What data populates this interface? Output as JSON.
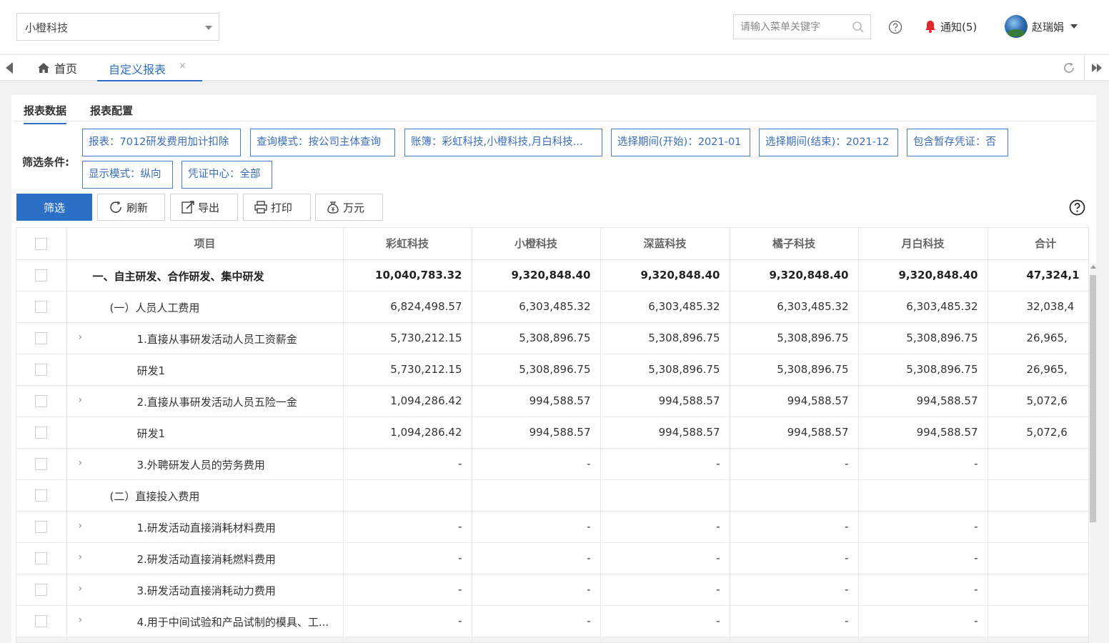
{
  "header": {
    "company_select": "小橙科技",
    "search_placeholder": "请输入菜单关键字",
    "notify_label": "通知(5)",
    "user_name": "赵瑞娟"
  },
  "tabs": {
    "home": "首页",
    "custom_report": "自定义报表",
    "close_symbol": "×"
  },
  "subtabs": {
    "data": "报表数据",
    "config": "报表配置"
  },
  "filters": {
    "label": "筛选条件:",
    "chips": [
      "报表：7012研发费用加计扣除",
      "查询模式：按公司主体查询",
      "账簿：彩虹科技,小橙科技,月白科技...",
      "选择期间(开始)：2021-01",
      "选择期间(结束)：2021-12",
      "包含暂存凭证：否",
      "显示模式：纵向",
      "凭证中心：全部"
    ]
  },
  "toolbar": {
    "filter": "筛选",
    "refresh": "刷新",
    "export": "导出",
    "print": "打印",
    "wan_yuan": "万元"
  },
  "table": {
    "columns": [
      "项目",
      "彩虹科技",
      "小橙科技",
      "深蓝科技",
      "橘子科技",
      "月白科技",
      "合计"
    ],
    "rows": [
      {
        "item": "一、自主研发、合作研发、集中研发",
        "values": [
          "10,040,783.32",
          "9,320,848.40",
          "9,320,848.40",
          "9,320,848.40",
          "9,320,848.40",
          "47,324,1"
        ]
      },
      {
        "item": "(一）人员人工费用",
        "values": [
          "6,824,498.57",
          "6,303,485.32",
          "6,303,485.32",
          "6,303,485.32",
          "6,303,485.32",
          "32,038,4"
        ]
      },
      {
        "item": "1.直接从事研发活动人员工资薪金",
        "values": [
          "5,730,212.15",
          "5,308,896.75",
          "5,308,896.75",
          "5,308,896.75",
          "5,308,896.75",
          "26,965,"
        ]
      },
      {
        "item": "研发1",
        "values": [
          "5,730,212.15",
          "5,308,896.75",
          "5,308,896.75",
          "5,308,896.75",
          "5,308,896.75",
          "26,965,"
        ]
      },
      {
        "item": "2.直接从事研发活动人员五险一金",
        "values": [
          "1,094,286.42",
          "994,588.57",
          "994,588.57",
          "994,588.57",
          "994,588.57",
          "5,072,6"
        ]
      },
      {
        "item": "研发1",
        "values": [
          "1,094,286.42",
          "994,588.57",
          "994,588.57",
          "994,588.57",
          "994,588.57",
          "5,072,6"
        ]
      },
      {
        "item": "3.外聘研发人员的劳务费用",
        "values": [
          "-",
          "-",
          "-",
          "-",
          "-",
          ""
        ]
      },
      {
        "item": "(二）直接投入费用",
        "values": [
          "",
          "",
          "",
          "",
          "",
          ""
        ]
      },
      {
        "item": "1.研发活动直接消耗材料费用",
        "values": [
          "-",
          "-",
          "-",
          "-",
          "-",
          ""
        ]
      },
      {
        "item": "2.研发活动直接消耗燃料费用",
        "values": [
          "-",
          "-",
          "-",
          "-",
          "-",
          ""
        ]
      },
      {
        "item": "3.研发活动直接消耗动力费用",
        "values": [
          "-",
          "-",
          "-",
          "-",
          "-",
          ""
        ]
      },
      {
        "item": "4.用于中间试验和产品试制的模具、工...",
        "values": [
          "-",
          "-",
          "-",
          "-",
          "-",
          ""
        ]
      }
    ],
    "expand_symbol": "›"
  }
}
